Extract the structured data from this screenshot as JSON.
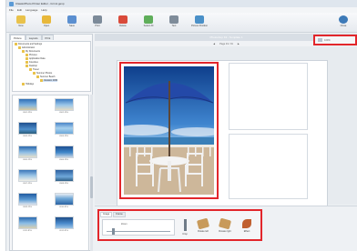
{
  "window": {
    "title": "ClassicPhoto Printer Editor - form1.gexp"
  },
  "menu": [
    "File",
    "Edit",
    "Language",
    "Help"
  ],
  "toolbar": [
    {
      "label": "New",
      "icon": "new-icon",
      "color": "#e9c24b"
    },
    {
      "label": "Open",
      "icon": "open-folder-icon",
      "color": "#e8b83a"
    },
    {
      "label": "Save",
      "icon": "save-icon",
      "color": "#5b8fd0"
    },
    {
      "label": "Print",
      "icon": "print-icon",
      "color": "#7c8a99"
    },
    {
      "label": "Delete",
      "icon": "delete-icon",
      "color": "#d94a3a"
    },
    {
      "label": "Select All",
      "icon": "select-all-icon",
      "color": "#5fae5a"
    },
    {
      "label": "Text",
      "icon": "text-icon",
      "color": "#7f8c9a"
    },
    {
      "label": "Picture Position",
      "icon": "picture-position-icon",
      "color": "#4a90c8"
    },
    {
      "label": "Close",
      "icon": "close-icon",
      "color": "#3d7ab8"
    }
  ],
  "sidebar": {
    "tabs": [
      "Picture",
      "Layouts",
      "Print"
    ],
    "tree": [
      "Documents and Settings",
      "Administrator",
      "My Documents",
      "Pictures",
      "Application Data",
      "Favorites",
      "Desktop",
      "Travel",
      "Summer Photos",
      "Summer Beach",
      "Vacation 2009",
      "Holidays"
    ],
    "thumbs": [
      "0101.JPG",
      "0102.JPG",
      "0103.JPG",
      "0104.JPG",
      "0105.JPG",
      "0106.JPG",
      "0107.JPG",
      "0108.JPG",
      "0109.JPG",
      "0110.JPG",
      "0111.JPG",
      "0112.JPG"
    ]
  },
  "workspace": {
    "header": "Photoshop Kit - Template 1",
    "page_label": "Page 01 / 01",
    "zoom": "100%"
  },
  "bottom": {
    "tabs": [
      "Image",
      "Frame"
    ],
    "slider_label": "Zoom",
    "buttons": [
      {
        "label": "Crop",
        "icon": "crop-icon",
        "color": "#6f7b88"
      },
      {
        "label": "Rotate left",
        "icon": "rotate-left-icon",
        "color": "#c89a5a"
      },
      {
        "label": "Rotate right",
        "icon": "rotate-right-icon",
        "color": "#c89a5a"
      },
      {
        "label": "Effect",
        "icon": "effect-icon",
        "color": "#c06030"
      }
    ]
  }
}
